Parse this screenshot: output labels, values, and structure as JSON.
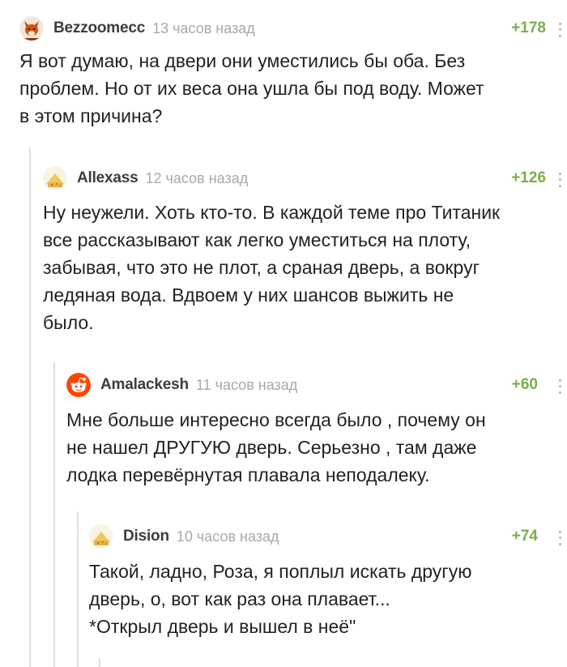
{
  "comments": [
    {
      "username": "Bezzoomecc",
      "time": "13 часов назад",
      "rating": "+178",
      "avatar": "fox-avatar-icon",
      "lines": [
        "Я вот думаю, на двери они уместились бы оба. Без",
        "проблем. Но от их веса она ушла бы под воду. Может",
        "в этом причина?"
      ]
    },
    {
      "username": "Allexass",
      "time": "12 часов назад",
      "rating": "+126",
      "avatar": "default-pikabu-avatar-icon",
      "lines": [
        "Ну неужели. Хоть кто-то. В каждой теме про Титаник",
        "все рассказывают как легко уместиться на плоту,",
        "забывая, что это не плот, а сраная дверь, а вокруг",
        "ледяная вода. Вдвоем у них шансов выжить не",
        "было."
      ]
    },
    {
      "username": "Amalackesh",
      "time": "11 часов назад",
      "rating": "+60",
      "avatar": "reddit-alien-avatar-icon",
      "lines": [
        "Мне больше интересно всегда было , почему он",
        "не нашел ДРУГУЮ дверь. Серьезно , там даже",
        "лодка перевёрнутая плавала неподалеку."
      ]
    },
    {
      "username": "Dision",
      "time": "10 часов назад",
      "rating": "+74",
      "avatar": "default-pikabu-avatar-icon",
      "lines": [
        "Такой, ладно, Роза, я поплыл искать другую",
        "дверь, о, вот как раз она плавает...",
        "*Открыл дверь и вышел в неё\""
      ]
    }
  ],
  "colors": {
    "rating_positive": "#7cad4a",
    "username": "#3d3d3d",
    "time": "#a8a8a8",
    "text": "#222222",
    "thread_line": "#dedede",
    "reddit_orange": "#ff4500"
  }
}
